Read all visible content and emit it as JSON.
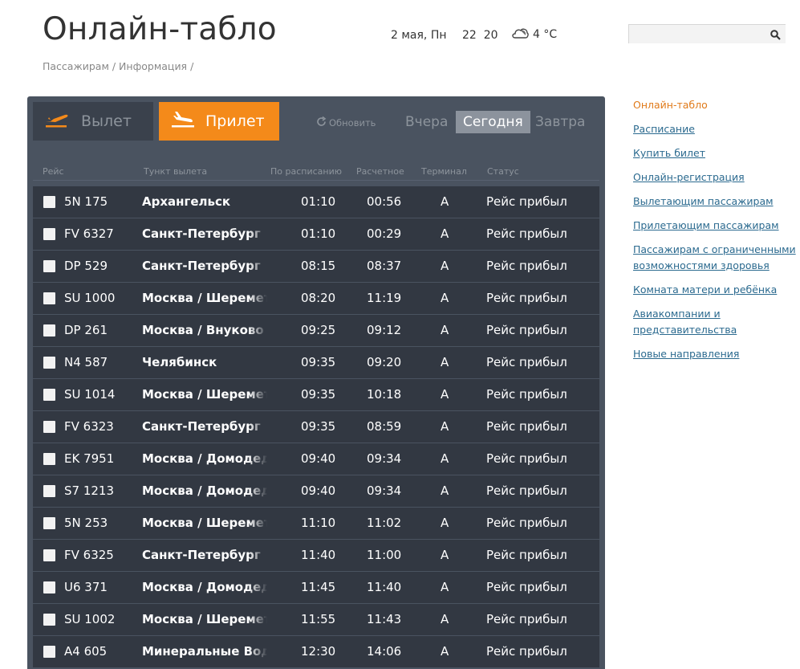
{
  "page": {
    "title": "Онлайн-табло",
    "breadcrumbs": [
      "Пассажирам",
      "Информация"
    ],
    "breadcrumb_sep": " / "
  },
  "header": {
    "date": "2 мая, Пн",
    "time_h": "22",
    "time_m": "20",
    "weather_temp": "4 °C",
    "search_placeholder": ""
  },
  "board": {
    "tabs": {
      "departure": "Вылет",
      "arrival": "Прилет"
    },
    "refresh": "Обновить",
    "days": {
      "yesterday": "Вчера",
      "today": "Сегодня",
      "tomorrow": "Завтра"
    },
    "columns": {
      "flight": "Рейс",
      "origin": "Тункт вылета",
      "scheduled": "По расписанию",
      "estimated": "Расчетное",
      "terminal": "Терминал",
      "status": "Статус"
    },
    "rows": [
      {
        "flight": "5N 175",
        "city": "Архангельск",
        "sch": "01:10",
        "est": "00:56",
        "term": "A",
        "status": "Рейс прибыл"
      },
      {
        "flight": "FV 6327",
        "city": "Санкт-Петербург",
        "sch": "01:10",
        "est": "00:29",
        "term": "A",
        "status": "Рейс прибыл"
      },
      {
        "flight": "DP 529",
        "city": "Санкт-Петербург",
        "sch": "08:15",
        "est": "08:37",
        "term": "A",
        "status": "Рейс прибыл"
      },
      {
        "flight": "SU 1000",
        "city": "Москва / Шереметьево",
        "sch": "08:20",
        "est": "11:19",
        "term": "A",
        "status": "Рейс прибыл"
      },
      {
        "flight": "DP 261",
        "city": "Москва / Внуково",
        "sch": "09:25",
        "est": "09:12",
        "term": "A",
        "status": "Рейс прибыл"
      },
      {
        "flight": "N4 587",
        "city": "Челябинск",
        "sch": "09:35",
        "est": "09:20",
        "term": "A",
        "status": "Рейс прибыл"
      },
      {
        "flight": "SU 1014",
        "city": "Москва / Шереметьево",
        "sch": "09:35",
        "est": "10:18",
        "term": "A",
        "status": "Рейс прибыл"
      },
      {
        "flight": "FV 6323",
        "city": "Санкт-Петербург",
        "sch": "09:35",
        "est": "08:59",
        "term": "A",
        "status": "Рейс прибыл"
      },
      {
        "flight": "EK 7951",
        "city": "Москва / Домодедово",
        "sch": "09:40",
        "est": "09:34",
        "term": "A",
        "status": "Рейс прибыл"
      },
      {
        "flight": "S7 1213",
        "city": "Москва / Домодедово",
        "sch": "09:40",
        "est": "09:34",
        "term": "A",
        "status": "Рейс прибыл"
      },
      {
        "flight": "5N 253",
        "city": "Москва / Шереметьево",
        "sch": "11:10",
        "est": "11:02",
        "term": "A",
        "status": "Рейс прибыл"
      },
      {
        "flight": "FV 6325",
        "city": "Санкт-Петербург",
        "sch": "11:40",
        "est": "11:00",
        "term": "A",
        "status": "Рейс прибыл"
      },
      {
        "flight": "U6 371",
        "city": "Москва / Домодедово",
        "sch": "11:45",
        "est": "11:40",
        "term": "A",
        "status": "Рейс прибыл"
      },
      {
        "flight": "SU 1002",
        "city": "Москва / Шереметьево",
        "sch": "11:55",
        "est": "11:43",
        "term": "A",
        "status": "Рейс прибыл"
      },
      {
        "flight": "A4 605",
        "city": "Минеральные Воды",
        "sch": "12:30",
        "est": "14:06",
        "term": "A",
        "status": "Рейс прибыл"
      }
    ]
  },
  "sidenav": [
    {
      "label": "Онлайн-табло",
      "current": true
    },
    {
      "label": "Расписание"
    },
    {
      "label": "Купить билет"
    },
    {
      "label": "Онлайн-регистрация"
    },
    {
      "label": "Вылетающим пассажирам"
    },
    {
      "label": "Прилетающим пассажирам"
    },
    {
      "label": "Пассажирам с ограниченными возможностями здоровья"
    },
    {
      "label": "Комната матери и ребёнка"
    },
    {
      "label": "Авиакомпании и представительства"
    },
    {
      "label": "Новые направления"
    }
  ],
  "colors": {
    "accent": "#f48a1a",
    "board": "#4a5360",
    "row": "#323842",
    "link": "#2b6a8f",
    "link_current": "#e07a1a"
  }
}
